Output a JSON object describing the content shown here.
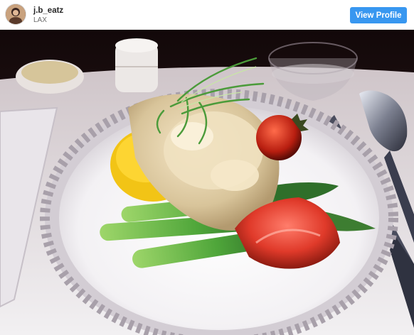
{
  "post": {
    "username": "j.b_eatz",
    "location": "LAX",
    "view_profile_label": "View Profile"
  },
  "icons": {
    "avatar": "profile-photo"
  },
  "photo": {
    "subject": "plated lobster meal on airline tray"
  },
  "colors": {
    "button": "#3897f0",
    "username": "#262626",
    "location": "#6b6b6b"
  }
}
